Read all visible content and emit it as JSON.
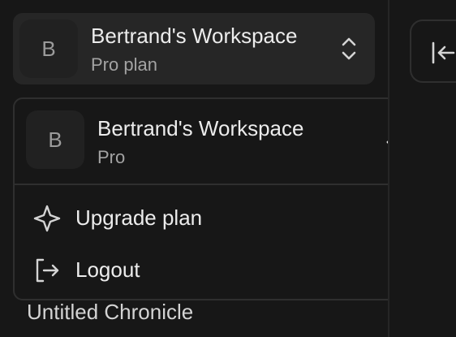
{
  "workspace_switcher": {
    "avatar_initial": "B",
    "name": "Bertrand's Workspace",
    "plan": "Pro plan",
    "chevron_icon": "chevron-up-down-icon"
  },
  "collapse_button": {
    "icon": "collapse-sidebar-icon"
  },
  "menu": {
    "workspace": {
      "avatar_initial": "B",
      "name": "Bertrand's Workspace",
      "plan": "Pro",
      "selected": true,
      "check_icon": "check-icon"
    },
    "items": [
      {
        "label": "Upgrade plan",
        "icon": "sparkle-icon"
      },
      {
        "label": "Logout",
        "icon": "logout-icon"
      }
    ]
  },
  "sidebar_items": [
    {
      "label": "Untitled Chronicle"
    }
  ],
  "colors": {
    "background": "#171717",
    "switcher_bg": "#262626",
    "border": "#2f2f2f",
    "text_primary": "#ececec",
    "text_secondary": "#a3a3a3"
  }
}
